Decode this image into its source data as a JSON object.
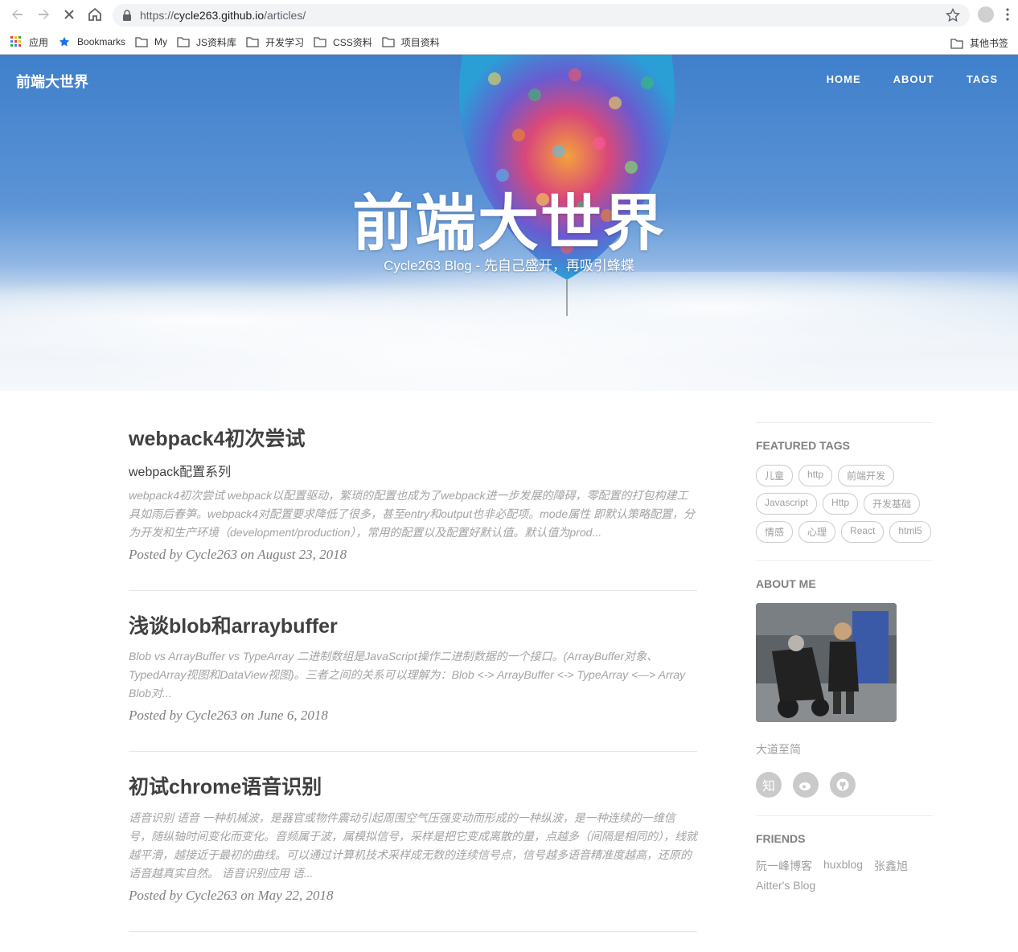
{
  "browser": {
    "url_prefix": "https://",
    "url_host": "cycle263.github.io",
    "url_path": "/articles/",
    "bookmarks": [
      {
        "label": "应用",
        "icon": "apps-grid-icon"
      },
      {
        "label": "Bookmarks",
        "icon": "star-icon"
      },
      {
        "label": "My",
        "icon": "folder-icon"
      },
      {
        "label": "JS资料库",
        "icon": "folder-icon"
      },
      {
        "label": "开发学习",
        "icon": "folder-icon"
      },
      {
        "label": "CSS资料",
        "icon": "folder-icon"
      },
      {
        "label": "项目资料",
        "icon": "folder-icon"
      }
    ],
    "other_bookmarks": "其他书签"
  },
  "site": {
    "brand": "前端大世界",
    "nav": [
      "HOME",
      "ABOUT",
      "TAGS"
    ],
    "hero_title": "前端大世界",
    "hero_subtitle": "Cycle263 Blog - 先自己盛开，再吸引蜂蝶"
  },
  "posts": [
    {
      "title": "webpack4初次尝试",
      "subtitle": "webpack配置系列",
      "excerpt": "webpack4初次尝试 webpack以配置驱动，繁琐的配置也成为了webpack进一步发展的障碍，零配置的打包构建工具如雨后春笋。webpack4对配置要求降低了很多，甚至entry和output也非必配项。mode属性 即默认策略配置，分为开发和生产环境（development/production），常用的配置以及配置好默认值。默认值为prod...",
      "meta": "Posted by Cycle263 on August 23, 2018"
    },
    {
      "title": "浅谈blob和arraybuffer",
      "subtitle": "",
      "excerpt": "Blob vs ArrayBuffer vs TypeArray 二进制数组是JavaScript操作二进制数据的一个接口。(ArrayBuffer对象、TypedArray视图和DataView视图)。三者之间的关系可以理解为：Blob <-> ArrayBuffer <-> TypeArray <—> Array Blob对...",
      "meta": "Posted by Cycle263 on June 6, 2018"
    },
    {
      "title": "初试chrome语音识别",
      "subtitle": "",
      "excerpt": "语音识别 语音 一种机械波，是器官或物件震动引起周围空气压强变动而形成的一种纵波，是一种连续的一维信号，随纵轴时间变化而变化。音频属于波，属模拟信号，采样是把它变成离散的量，点越多（间隔是相同的），线就越平滑，越接近于最初的曲线。可以通过计算机技术采样成无数的连续信号点，信号越多语音精准度越高，还原的语音越真实自然。 语音识别应用 语...",
      "meta": "Posted by Cycle263 on May 22, 2018"
    }
  ],
  "sidebar": {
    "featured_tags_title": "FEATURED TAGS",
    "tags": [
      "儿童",
      "http",
      "前端开发",
      "Javascript",
      "Http",
      "开发基础",
      "情感",
      "心理",
      "React",
      "html5"
    ],
    "about_title": "ABOUT ME",
    "about_desc": "大道至简",
    "socials": [
      {
        "label": "知",
        "icon": "zhihu-icon"
      },
      {
        "label": "",
        "icon": "weibo-icon"
      },
      {
        "label": "",
        "icon": "github-icon"
      }
    ],
    "friends_title": "FRIENDS",
    "friends": [
      "阮一峰博客",
      "huxblog",
      "张鑫旭",
      "Aitter's Blog"
    ]
  }
}
